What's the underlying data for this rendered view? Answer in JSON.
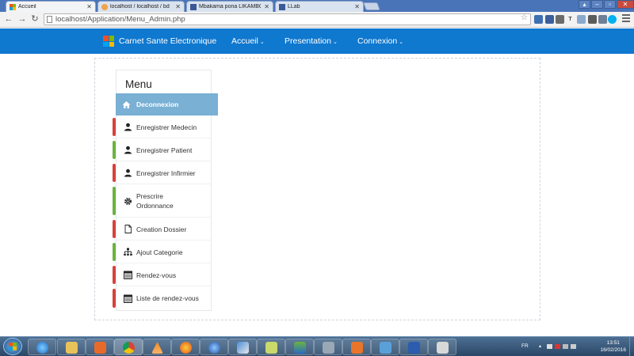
{
  "browser": {
    "tabs": [
      {
        "title": "Accueil",
        "active": true
      },
      {
        "title": "localhost / localhost / bd",
        "active": false
      },
      {
        "title": "Mbakama pona LIKAMBC",
        "active": false
      },
      {
        "title": "LLab",
        "active": false
      }
    ],
    "address": "localhost/Application/Menu_Admin.php"
  },
  "navbar": {
    "brand": "Carnet Sante Electronique",
    "items": [
      "Accueil",
      "Presentation",
      "Connexion"
    ],
    "caret": "⌄",
    "color": "#0f78cf"
  },
  "menu": {
    "heading": "Menu",
    "items": [
      {
        "label": "Deconnexion",
        "icon": "home-icon",
        "active": true,
        "accent": "#79b0d4"
      },
      {
        "label": "Enregistrer Medecin",
        "icon": "user-icon",
        "accent": "#d9413a"
      },
      {
        "label": "Enregistrer Patient",
        "icon": "user-icon",
        "accent": "#6cb33f"
      },
      {
        "label": "Enregistrer Infirmier",
        "icon": "user-icon",
        "accent": "#d9413a"
      },
      {
        "label": "Prescrire Ordonnance",
        "icon": "gear-icon",
        "accent": "#6cb33f"
      },
      {
        "label": "Creation Dossier",
        "icon": "file-icon",
        "accent": "#d9413a"
      },
      {
        "label": "Ajout Categorie",
        "icon": "sitemap-icon",
        "accent": "#6cb33f"
      },
      {
        "label": "Rendez-vous",
        "icon": "calendar-icon",
        "accent": "#d9413a"
      },
      {
        "label": "Liste de rendez-vous",
        "icon": "calendar-icon",
        "accent": "#d9413a"
      }
    ]
  },
  "taskbar": {
    "clock_time": "13:51",
    "clock_date": "16/02/2016",
    "language": "FR"
  }
}
